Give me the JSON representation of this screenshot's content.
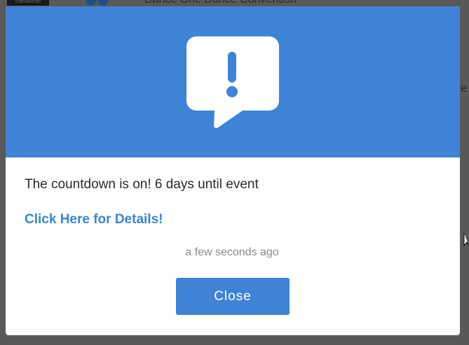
{
  "background": {
    "logo_text": "CONVENTION",
    "title": "Dance One Dance Convention",
    "edge_glyph": "e"
  },
  "modal": {
    "header_color": "#3f83d6",
    "icon": "speech-bubble-exclamation-icon",
    "message": "The countdown is on! 6 days until event",
    "link_text": "Click Here for Details!",
    "timestamp": "a few seconds ago",
    "close_label": "Close"
  }
}
